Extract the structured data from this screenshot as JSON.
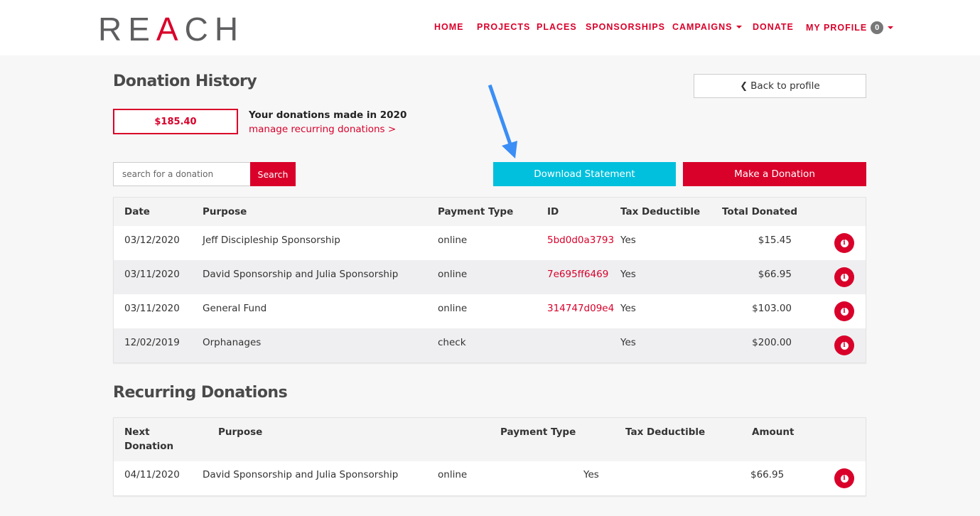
{
  "brand": {
    "logo_pre": "RE",
    "logo_a": "A",
    "logo_post": "CH",
    "accent_color": "#d9002a",
    "cyan_color": "#00c0dd"
  },
  "nav": {
    "items": [
      {
        "label": "HOME"
      },
      {
        "label": "PROJECTS"
      },
      {
        "label": "PLACES"
      },
      {
        "label": "SPONSORSHIPS"
      },
      {
        "label": "CAMPAIGNS",
        "dropdown": true
      },
      {
        "label": "DONATE"
      },
      {
        "label": "MY PROFILE",
        "dropdown": true,
        "badge": "0"
      }
    ]
  },
  "page": {
    "title": "Donation History",
    "back_label": "Back to profile",
    "total_amount": "$185.40",
    "total_label": "Your donations made in 2020",
    "manage_link": "manage recurring donations >",
    "search_placeholder": "search for a donation",
    "search_button": "Search",
    "download_button": "Download Statement",
    "donate_button": "Make a Donation"
  },
  "history": {
    "headers": [
      "Date",
      "Purpose",
      "Payment Type",
      "ID",
      "Tax Deductible",
      "Total Donated"
    ],
    "rows": [
      {
        "date": "03/12/2020",
        "purpose": "Jeff Discipleship Sponsorship",
        "payment": "online",
        "id": "5bd0d0a3793",
        "tax": "Yes",
        "total": "$15.45"
      },
      {
        "date": "03/11/2020",
        "purpose": "David Sponsorship and Julia Sponsorship",
        "payment": "online",
        "id": "7e695ff6469",
        "tax": "Yes",
        "total": "$66.95"
      },
      {
        "date": "03/11/2020",
        "purpose": "General Fund",
        "payment": "online",
        "id": "314747d09e4",
        "tax": "Yes",
        "total": "$103.00"
      },
      {
        "date": "12/02/2019",
        "purpose": "Orphanages",
        "payment": "check",
        "id": "",
        "tax": "Yes",
        "total": "$200.00"
      }
    ]
  },
  "recurring": {
    "title": "Recurring Donations",
    "headers": [
      "Next",
      "Donation",
      "Purpose",
      "Payment Type",
      "Tax Deductible",
      "Amount"
    ],
    "rows": [
      {
        "date": "04/11/2020",
        "purpose": "David Sponsorship and Julia Sponsorship",
        "payment": "online",
        "tax": "Yes",
        "amount": "$66.95"
      }
    ]
  },
  "icons": {
    "info": "info-circle-icon",
    "back": "chevron-left-icon",
    "caret": "caret-down-icon",
    "annotation": "arrow-annotation-icon"
  }
}
